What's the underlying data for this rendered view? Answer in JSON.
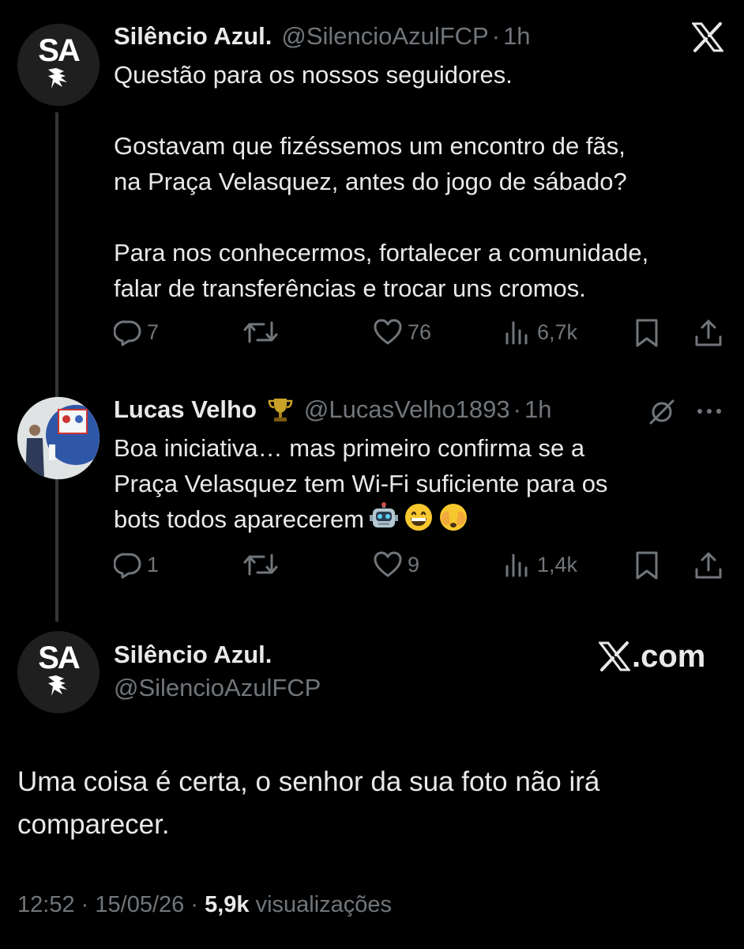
{
  "tweet1": {
    "avatar_text": "SA",
    "name": "Silêncio Azul.",
    "handle": "@SilencioAzulFCP",
    "separator": "·",
    "time": "1h",
    "body": "Questão para os nossos seguidores.\n\nGostavam que fizéssemos um encontro de fãs,\nna Praça Velasquez, antes do jogo de sábado?\n\nPara nos conhecermos, fortalecer a comunidade,\nfalar de transferências e trocar uns cromos.",
    "replies": "7",
    "likes": "76",
    "views": "6,7k"
  },
  "tweet2": {
    "name": "Lucas Velho",
    "handle": "@LucasVelho1893",
    "separator": "·",
    "time": "1h",
    "body": "Boa iniciativa… mas primeiro confirma se a\nPraça Velasquez tem Wi-Fi suficiente para os\nbots todos aparecerem",
    "emojis": [
      "robot-emoji",
      "grinning-emoji",
      "face-peeking-emoji"
    ],
    "replies": "1",
    "likes": "9",
    "views": "1,4k"
  },
  "tweet3": {
    "avatar_text": "SA",
    "name": "Silêncio Azul.",
    "handle": "@SilencioAzulFCP",
    "brand": ".com",
    "body": "Uma coisa é certa, o senhor da sua foto não irá\ncomparecer.",
    "time": "12:52",
    "separator": "·",
    "date": "15/05/26",
    "separator2": "·",
    "views_count": "5,9k",
    "views_label": "visualizações"
  },
  "colors": {
    "background": "#000000",
    "text": "#e7e9ea",
    "muted": "#71767b",
    "thread_line": "#333639"
  }
}
